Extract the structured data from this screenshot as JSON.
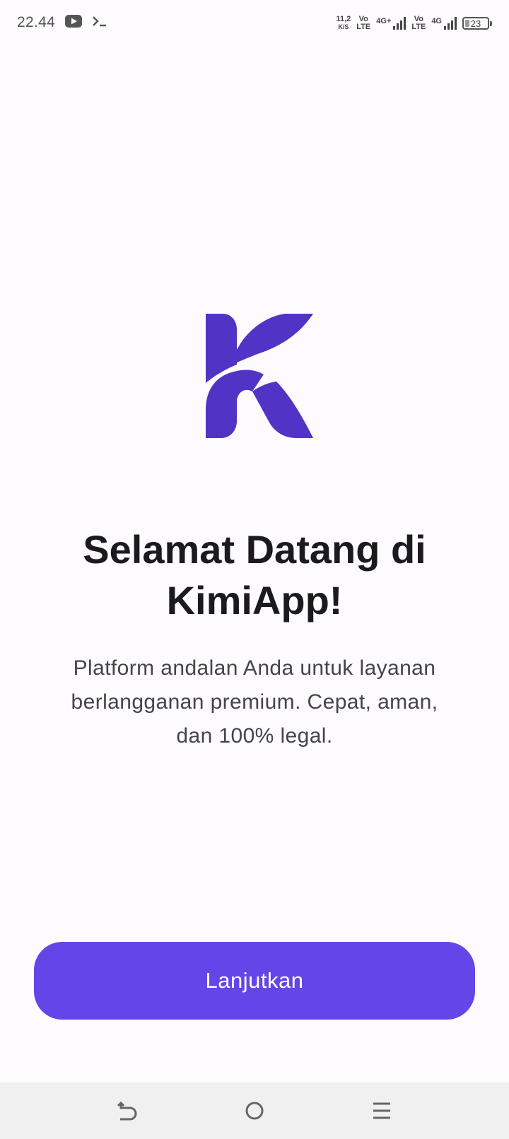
{
  "status_bar": {
    "time": "22.44",
    "left_icons": [
      "youtube-icon",
      "terminal-icon"
    ],
    "speed_value": "11,2",
    "speed_unit": "K/S",
    "volte_1_top": "Vo",
    "volte_1_bottom": "LTE",
    "net_1_label": "4G+",
    "volte_2_top": "Vo",
    "volte_2_bottom": "LTE",
    "net_2_label": "4G",
    "battery_level": "23"
  },
  "logo": {
    "icon": "kimiapp-k-logo",
    "color": "#5134c6"
  },
  "welcome": {
    "title_line1": "Selamat Datang di",
    "title_line2": "KimiApp!",
    "subtitle_line1": "Platform andalan Anda untuk layanan",
    "subtitle_line2": "berlangganan premium. Cepat, aman,",
    "subtitle_line3": "dan 100% legal."
  },
  "cta": {
    "label": "Lanjutkan",
    "color": "#6246e8"
  },
  "nav_bar": {
    "icons": [
      "back-icon",
      "home-icon",
      "menu-icon"
    ]
  }
}
